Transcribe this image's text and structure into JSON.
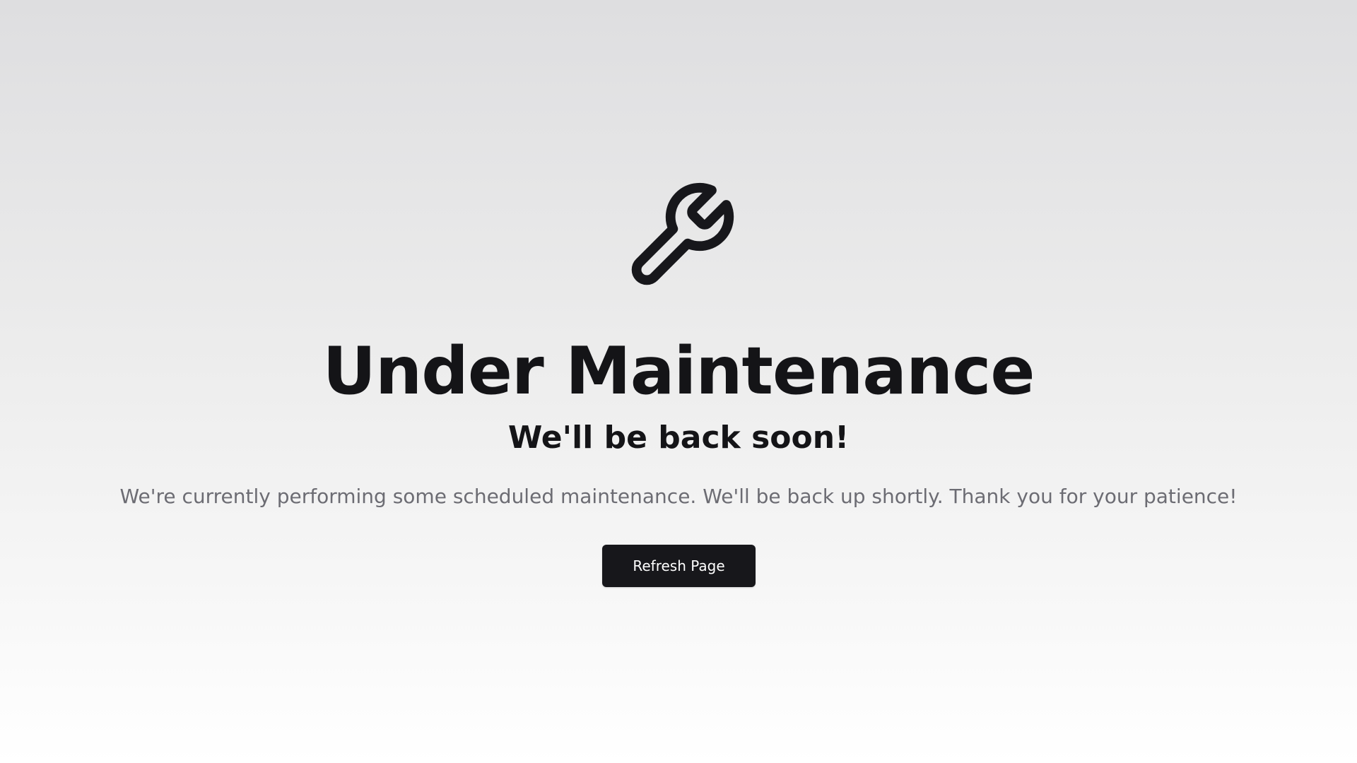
{
  "main": {
    "icon": "wrench-icon",
    "title": "Under Maintenance",
    "subtitle": "We'll be back soon!",
    "message": "We're currently performing some scheduled maintenance. We'll be back up shortly. Thank you for your patience!",
    "refresh_button_label": "Refresh Page"
  },
  "colors": {
    "button_background": "#17171b",
    "button_text": "#ffffff",
    "heading_text": "#141417",
    "message_text": "#6c6c73"
  }
}
